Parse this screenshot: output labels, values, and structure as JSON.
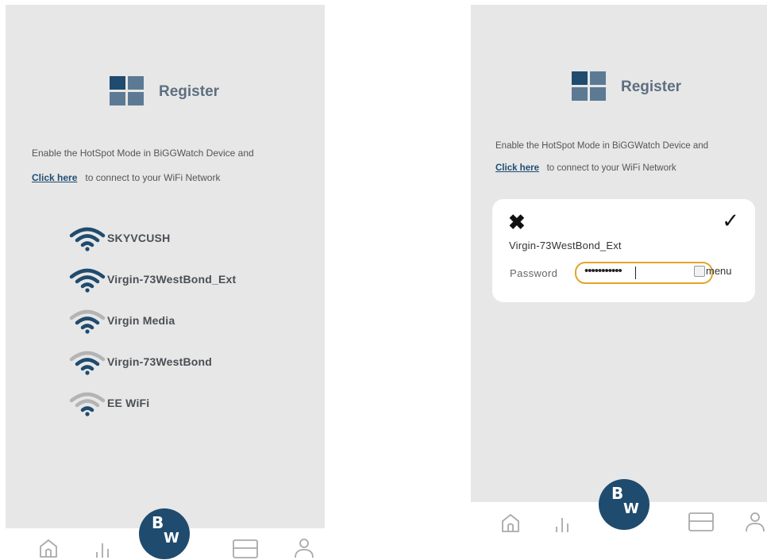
{
  "colors": {
    "bg_screen": "#e7e7e7",
    "accent": "#1f4b6e",
    "focus_border": "#e3a429",
    "title": "#5d6f80"
  },
  "screen_list": {
    "header": {
      "title": "Register"
    },
    "intro": {
      "line1": "Enable the HotSpot Mode in BiGGWatch Device and",
      "link": "Click here",
      "line2_rest": "to connect to your WiFi Network"
    },
    "networks": [
      {
        "ssid": "SKYVCUSH",
        "signal": "strong"
      },
      {
        "ssid": "Virgin-73WestBond_Ext",
        "signal": "strong"
      },
      {
        "ssid": "Virgin Media",
        "signal": "medium"
      },
      {
        "ssid": "Virgin-73WestBond",
        "signal": "medium"
      },
      {
        "ssid": "EE WiFi",
        "signal": "weak"
      }
    ]
  },
  "screen_password": {
    "header": {
      "title": "Register"
    },
    "intro": {
      "line1": "Enable the HotSpot Mode in BiGGWatch Device and",
      "link": "Click here",
      "line2_rest": "to connect to your WiFi Network"
    },
    "dialog": {
      "close_glyph": "✖",
      "confirm_glyph": "✓",
      "ssid": "Virgin-73WestBond_Ext",
      "password_label": "Password",
      "password_value": "•••••••••••",
      "menu_alt": "menu"
    }
  },
  "fab": {
    "top": "B",
    "bottom": "W"
  },
  "nav_icons": [
    "home-icon",
    "stats-icon",
    "card-icon",
    "profile-icon"
  ]
}
